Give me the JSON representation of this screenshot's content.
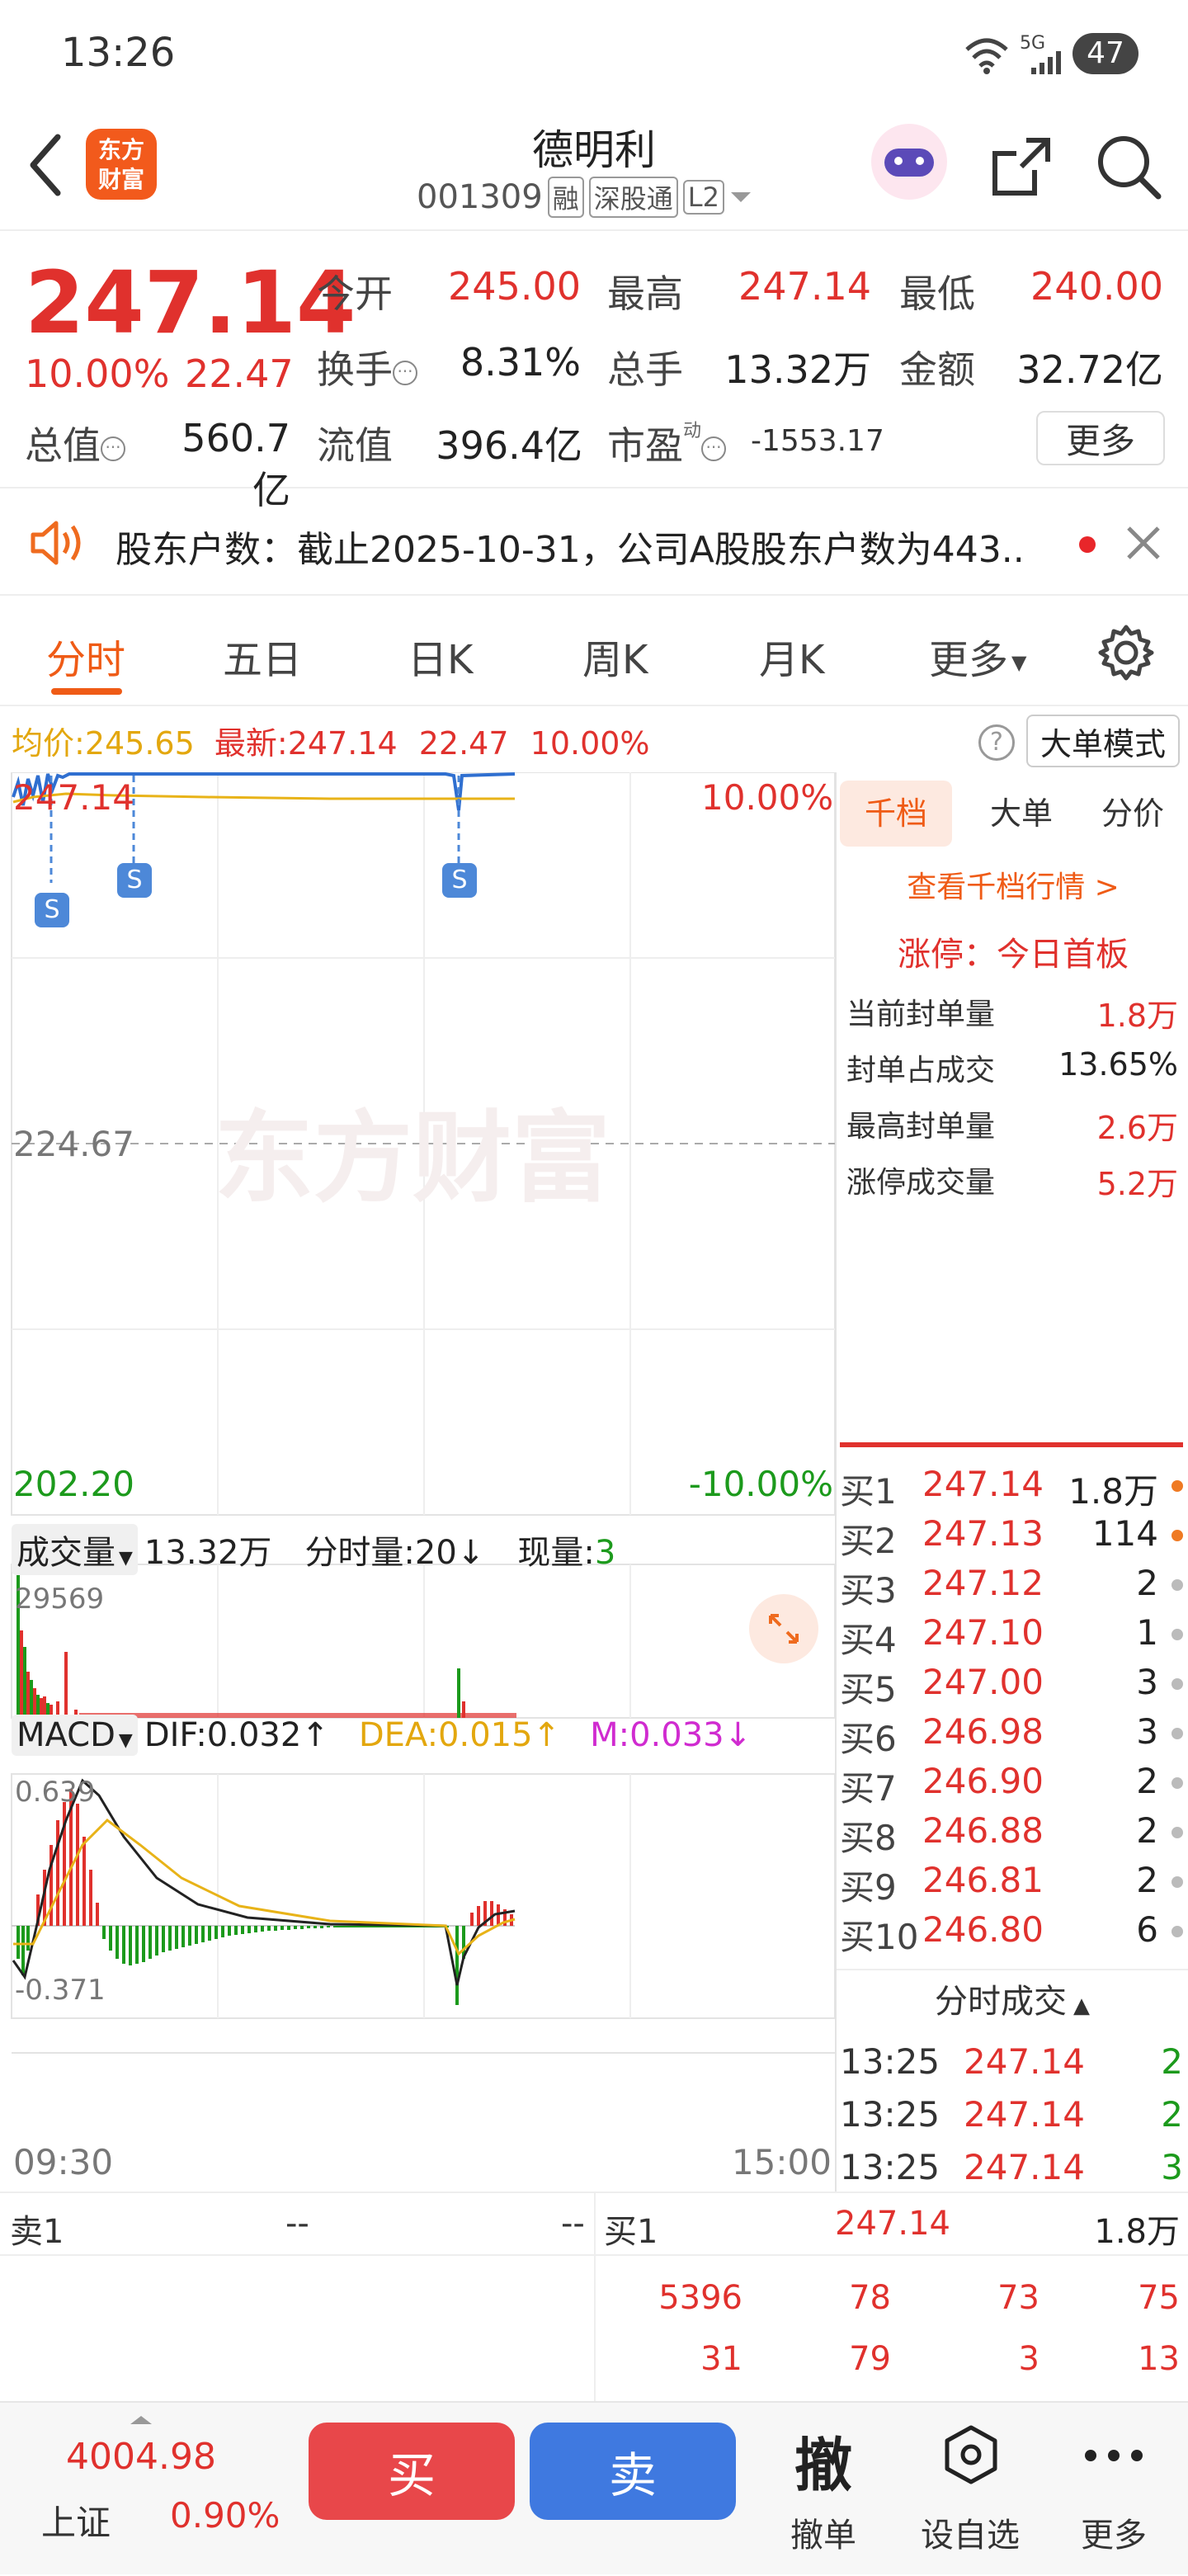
{
  "status": {
    "time": "13:26",
    "battery": "47",
    "network": "5G"
  },
  "nav": {
    "logo_line1": "东方",
    "logo_line2": "财富",
    "title": "德明利",
    "code": "001309",
    "tags": [
      "融",
      "深股通",
      "L2"
    ]
  },
  "quote": {
    "price": "247.14",
    "change_pct": "10.00%",
    "change": "22.47",
    "open_label": "今开",
    "open": "245.00",
    "high_label": "最高",
    "high": "247.14",
    "low_label": "最低",
    "low": "240.00",
    "turnover_label": "换手",
    "turnover": "8.31%",
    "volume_label": "总手",
    "volume": "13.32万",
    "amount_label": "金额",
    "amount": "32.72亿",
    "mcap_label": "总值",
    "mcap": "560.7亿",
    "float_label": "流值",
    "float": "396.4亿",
    "pe_label": "市盈",
    "pe_sup": "动",
    "pe": "-1553.17",
    "more": "更多"
  },
  "notice": {
    "text": "股东户数：截止2025-10-31，公司A股股东户数为443.."
  },
  "tabs": [
    "分时",
    "五日",
    "日K",
    "周K",
    "月K",
    "更多"
  ],
  "avgbar": {
    "avg_label": "均价:",
    "avg": "245.65",
    "latest_label": "最新:",
    "latest": "247.14",
    "chg": "22.47",
    "pct": "10.00%",
    "mode": "大单模式"
  },
  "chart": {
    "top_price": "247.14",
    "top_pct": "10.00%",
    "mid_price": "224.67",
    "bottom_price": "202.20",
    "bottom_pct": "-10.00%",
    "watermark": "东方财富",
    "s_marker": "S",
    "time_start": "09:30",
    "time_end": "15:00"
  },
  "volume": {
    "label": "成交量",
    "total": "13.32万",
    "minute_label": "分时量:20",
    "arrow_down": "↓",
    "now_label": "现量:",
    "now": "3",
    "max": "29569"
  },
  "macd": {
    "label": "MACD",
    "dif": "DIF:0.032",
    "dea": "DEA:0.015",
    "m": "M:0.033",
    "up": "↑",
    "down": "↓",
    "top": "0.639",
    "bottom": "-0.371"
  },
  "side": {
    "tabs": [
      "千档",
      "大单",
      "分价"
    ],
    "link": "查看千档行情 >",
    "limit_title": "涨停：今日首板",
    "stats": [
      {
        "label": "当前封单量",
        "value": "1.8万"
      },
      {
        "label": "封单占成交",
        "value": "13.65%"
      },
      {
        "label": "最高封单量",
        "value": "2.6万"
      },
      {
        "label": "涨停成交量",
        "value": "5.2万"
      }
    ]
  },
  "orderbook": [
    {
      "label": "买1",
      "price": "247.14",
      "vol": "1.8万"
    },
    {
      "label": "买2",
      "price": "247.13",
      "vol": "114"
    },
    {
      "label": "买3",
      "price": "247.12",
      "vol": "2"
    },
    {
      "label": "买4",
      "price": "247.10",
      "vol": "1"
    },
    {
      "label": "买5",
      "price": "247.00",
      "vol": "3"
    },
    {
      "label": "买6",
      "price": "246.98",
      "vol": "3"
    },
    {
      "label": "买7",
      "price": "246.90",
      "vol": "2"
    },
    {
      "label": "买8",
      "price": "246.88",
      "vol": "2"
    },
    {
      "label": "买9",
      "price": "246.81",
      "vol": "2"
    },
    {
      "label": "买10",
      "price": "246.80",
      "vol": "6"
    }
  ],
  "ticks": {
    "title": "分时成交",
    "rows": [
      {
        "time": "13:25",
        "price": "247.14",
        "vol": "2"
      },
      {
        "time": "13:25",
        "price": "247.14",
        "vol": "2"
      },
      {
        "time": "13:25",
        "price": "247.14",
        "vol": "3"
      }
    ]
  },
  "bottomtable": {
    "sell_label": "卖1",
    "sell_price": "--",
    "sell_vol": "--",
    "buy_label": "买1",
    "buy_price": "247.14",
    "buy_vol": "1.8万",
    "row1": [
      "5396",
      "78",
      "73",
      "75"
    ],
    "row2": [
      "31",
      "79",
      "3",
      "13"
    ]
  },
  "toolbar": {
    "index_value": "4004.98",
    "index_name": "上证",
    "index_pct": "0.90%",
    "buy": "买",
    "sell": "卖",
    "cancel_icon": "撤",
    "cancel": "撤单",
    "watch": "设自选",
    "more": "更多"
  }
}
